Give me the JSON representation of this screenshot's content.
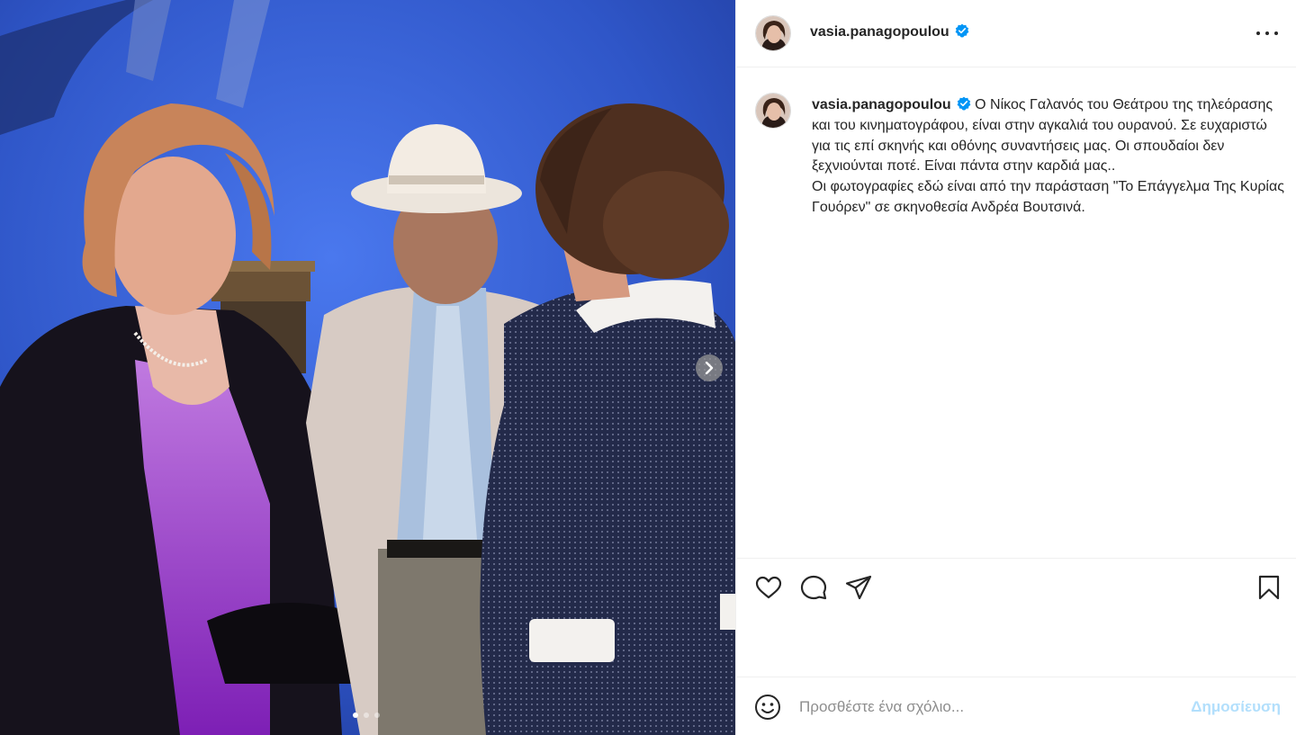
{
  "post": {
    "username": "vasia.panagopoulou",
    "verified": true,
    "caption": "Ο Νίκος Γαλανός του Θεάτρου της τηλεόρασης και του κινηματογράφου, είναι στην αγκαλιά του ουρανού. Σε ευχαριστώ για τις επί σκηνής και οθόνης συναντήσεις μας. Οι σπουδαίοι δεν ξεχνιούνται ποτέ. Είναι πάντα στην καρδιά μας..\nΟι φωτογραφίες εδώ είναι από την παράσταση \"Το Επάγγελμα Της Κυρίας Γουόρεν\" σε σκηνοθεσία Ανδρέα Βουτσινά."
  },
  "carousel": {
    "total_slides": 3,
    "active_slide": 1
  },
  "actions": {
    "icons": [
      "heart-icon",
      "comment-icon",
      "share-icon",
      "bookmark-icon"
    ]
  },
  "comment_box": {
    "placeholder": "Προσθέστε ένα σχόλιο...",
    "post_label": "Δημοσίευση",
    "post_label_color": "#b2dffc"
  },
  "colors": {
    "stage_background": "#3a63d6",
    "verified_badge": "#0095f6",
    "text": "#262626",
    "muted": "#8e8e8e"
  }
}
